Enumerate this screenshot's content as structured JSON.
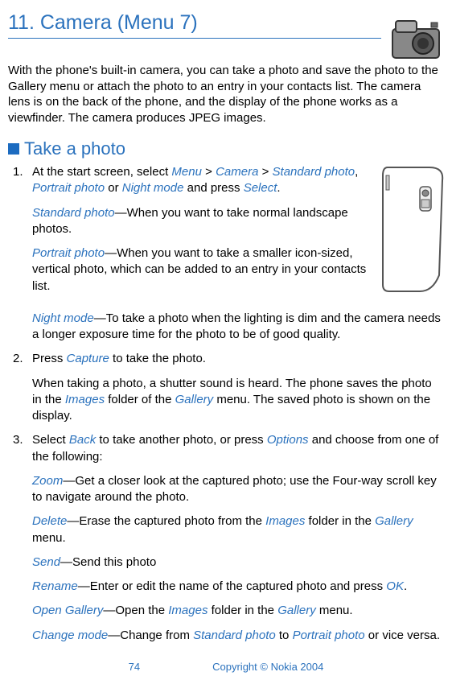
{
  "heading": "11. Camera (Menu 7)",
  "intro": "With the phone's built-in camera, you can take a photo and save the photo to the Gallery menu or attach the photo to an entry in your contacts list. The camera lens is on the back of the phone, and the display of the phone works as a viewfinder. The camera produces JPEG images.",
  "section": {
    "title": "Take a photo"
  },
  "steps": {
    "s1": {
      "num": "1.",
      "lead": "At the start screen, select ",
      "menu": "Menu",
      "gt1": " > ",
      "camera": "Camera",
      "gt2": " > ",
      "std": "Standard photo",
      "comma1": ", ",
      "port": "Portrait photo",
      "or": " or ",
      "night": "Night mode",
      "and": " and press ",
      "select": "Select",
      "dot": ".",
      "std_label": "Standard photo",
      "std_text": "—When you want to take normal landscape photos.",
      "port_label": "Portrait photo",
      "port_text": "—When you want to take a smaller icon-sized, vertical photo, which can be added to an entry in your contacts list.",
      "night_label": "Night mode",
      "night_text": "—To take a photo when the lighting is dim and the camera needs a longer exposure time for the photo to be of good quality."
    },
    "s2": {
      "num": "2.",
      "t1": "Press ",
      "capture": "Capture",
      "t2": " to take the photo.",
      "p1a": "When taking a photo, a shutter sound is heard. The phone saves the photo in the ",
      "images": "Images",
      "p1b": " folder of the ",
      "gallery": "Gallery",
      "p1c": " menu. The saved photo is shown on the display."
    },
    "s3": {
      "num": "3.",
      "t1": "Select ",
      "back": "Back",
      "t2": " to take another photo, or press ",
      "options": "Options",
      "t3": " and choose from one of the following:",
      "zoom": "Zoom",
      "zoom_t": "—Get a closer look at the captured photo; use the Four-way scroll key to navigate around the photo.",
      "delete": "Delete",
      "delete_t1": "—Erase the captured photo from the ",
      "images": "Images",
      "delete_t2": " folder in the ",
      "gallery": "Gallery",
      "delete_t3": " menu.",
      "send": "Send",
      "send_t": "—Send this photo",
      "rename": "Rename",
      "rename_t1": "—Enter or edit the name of the captured photo and press ",
      "ok": "OK",
      "rename_t2": ".",
      "open": "Open Gallery",
      "open_t1": "—Open the ",
      "open_images": "Images",
      "open_t2": " folder in the ",
      "open_gallery": "Gallery",
      "open_t3": " menu.",
      "change": "Change mode",
      "change_t1": "—Change from ",
      "change_std": "Standard photo",
      "change_t2": " to ",
      "change_port": "Portrait photo",
      "change_t3": " or vice versa."
    }
  },
  "footer": {
    "page": "74",
    "copyright": "Copyright © Nokia 2004"
  }
}
